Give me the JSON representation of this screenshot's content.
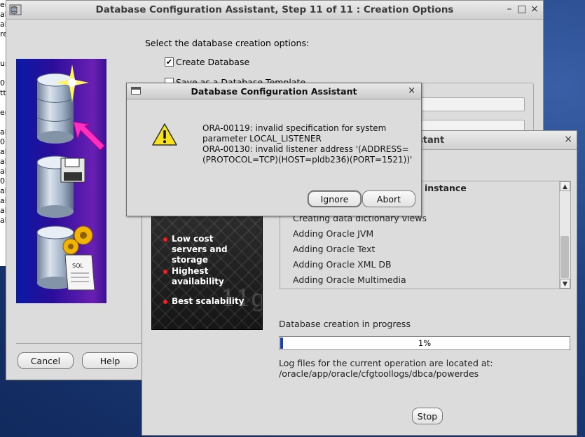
{
  "main_window": {
    "title": "Database Configuration Assistant, Step 11 of 11 : Creation Options",
    "controls": {
      "minimize": "–",
      "maximize": "□",
      "close": "×"
    },
    "prompt": "Select the database creation options:",
    "create_database_label": "Create Database",
    "create_database_checked": true,
    "save_template_label": "Save as a Database Template",
    "save_template_checked": false,
    "cancel_label": "Cancel",
    "help_label": "Help"
  },
  "progress_window": {
    "title_fragment": "stant",
    "close": "×",
    "promo": {
      "bullets": [
        "Low cost servers and storage",
        "Highest availability",
        "Best scalability"
      ],
      "logo_text": "11g"
    },
    "steps": [
      {
        "label": "instance",
        "bold": true
      },
      {
        "label": "Creating data dictionary views",
        "bold": false
      },
      {
        "label": "Adding Oracle JVM",
        "bold": false
      },
      {
        "label": "Adding Oracle Text",
        "bold": false
      },
      {
        "label": "Adding Oracle XML DB",
        "bold": false
      },
      {
        "label": "Adding Oracle Multimedia",
        "bold": false
      }
    ],
    "status_label": "Database creation in progress",
    "progress_percent": 1,
    "progress_text": "1%",
    "log_line1": "Log files for the current operation are located at:",
    "log_line2": "/oracle/app/oracle/cfgtoollogs/dbca/powerdes",
    "stop_label": "Stop"
  },
  "error_dialog": {
    "title": "Database Configuration Assistant",
    "close": "×",
    "icon": "warning-icon",
    "message_lines": [
      "ORA-00119: invalid specification for system",
      "parameter LOCAL_LISTENER",
      "ORA-00130: invalid listener address '(ADDRESS=",
      "(PROTOCOL=TCP)(HOST=pldb236)(PORT=1521))'"
    ],
    "ignore_label": "Ignore",
    "abort_label": "Abort"
  },
  "left_strip_fragments": [
    "en",
    "ab",
    "ab",
    "re",
    "",
    "",
    "us",
    "",
    "0",
    "tt",
    "",
    "en",
    "",
    "ab",
    "0",
    "ab",
    "ab",
    "ab",
    "0",
    "ab",
    "ab",
    "ab",
    "ab"
  ]
}
